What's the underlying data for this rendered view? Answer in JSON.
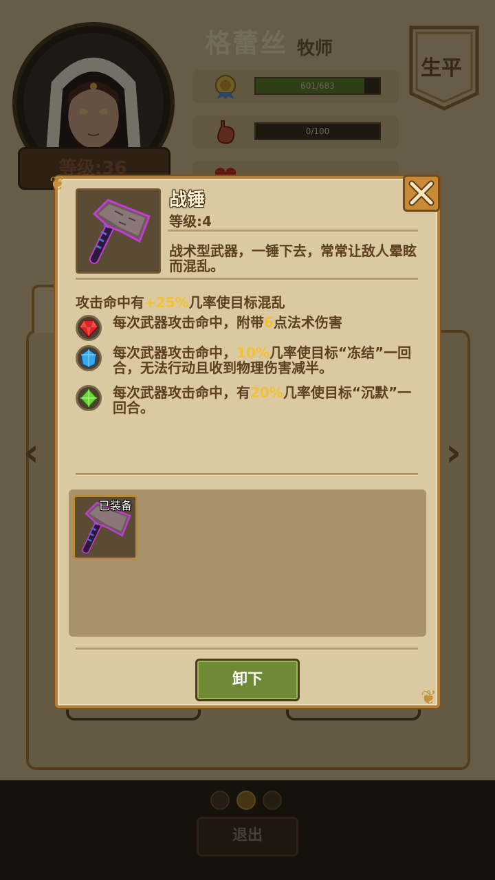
{
  "hero": {
    "name": "格蕾丝",
    "class": "牧师",
    "level_label": "等级:36",
    "life_tab": "生平",
    "stats": [
      {
        "icon": "medal-icon",
        "text": "601/683",
        "fill": 0.88
      },
      {
        "icon": "stomach-icon",
        "text": "0/100",
        "fill": 0
      }
    ]
  },
  "modal": {
    "item_name": "战锤",
    "item_level": "等级:4",
    "item_desc": "战术型武器，一锤下去，常常让敌人晕眩而混乱。",
    "effect_main": {
      "pre": "攻击命中有",
      "hl": "+25%",
      "post": "几率使目标混乱"
    },
    "gems": [
      {
        "icon": "red-gem-icon",
        "color": "#d8262a",
        "pre": "每次武器攻击命中，附带",
        "hl": "6",
        "post": "点法术伤害"
      },
      {
        "icon": "blue-gem-icon",
        "color": "#3aa8e8",
        "pre": "每次武器攻击命中，",
        "hl": "10%",
        "post": "几率使目标“冻结”一回合，无法行动且收到物理伤害减半。"
      },
      {
        "icon": "green-gem-icon",
        "color": "#6cd63a",
        "pre": "每次武器攻击命中，有",
        "hl": "20%",
        "post": "几率使目标“沉默”一回合。"
      }
    ],
    "equipped_tag": "已装备",
    "unequip_label": "卸下"
  },
  "footer": {
    "exit_label": "退出",
    "page_count": 3,
    "active_page": 2
  },
  "colors": {
    "highlight": "#f3c232",
    "button_green": "#6f8a34",
    "frame_gold": "#b4813a"
  }
}
